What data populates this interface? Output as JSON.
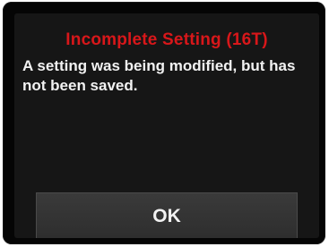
{
  "dialog": {
    "title": "Incomplete Setting (16T)",
    "message": "A setting was being modified, but has not been saved.",
    "ok_label": "OK"
  },
  "colors": {
    "title": "#d8171a",
    "screen_background": "#161616",
    "text": "#f2f2f2",
    "button_background": "#333333"
  }
}
